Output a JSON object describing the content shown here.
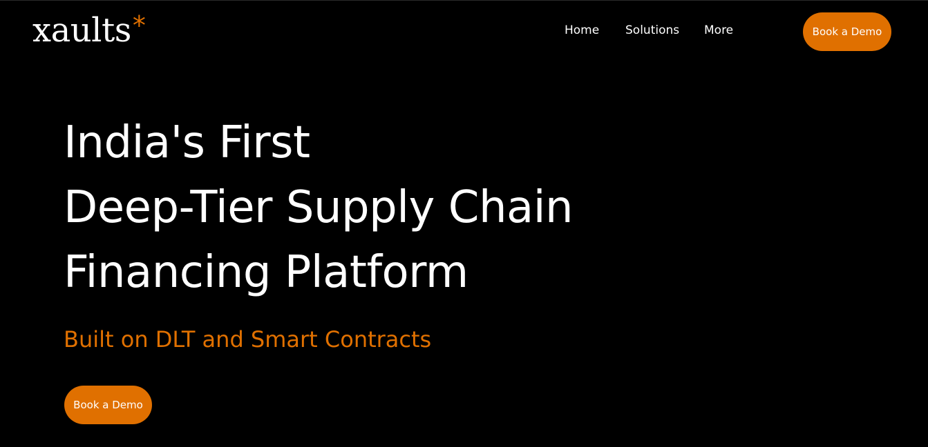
{
  "brand": {
    "name": "xaults",
    "mark": "*",
    "accent_color": "#e07000"
  },
  "nav": {
    "items": [
      {
        "label": "Home"
      },
      {
        "label": "Solutions"
      },
      {
        "label": "More"
      }
    ],
    "cta_label": "Book a Demo"
  },
  "hero": {
    "title_lines": [
      "India's First",
      "Deep-Tier Supply Chain",
      "Financing Platform"
    ],
    "subtitle": "Built on DLT and Smart Contracts",
    "cta_label": "Book a Demo"
  },
  "colors": {
    "background": "#000000",
    "text": "#ffffff",
    "accent": "#e07000"
  }
}
